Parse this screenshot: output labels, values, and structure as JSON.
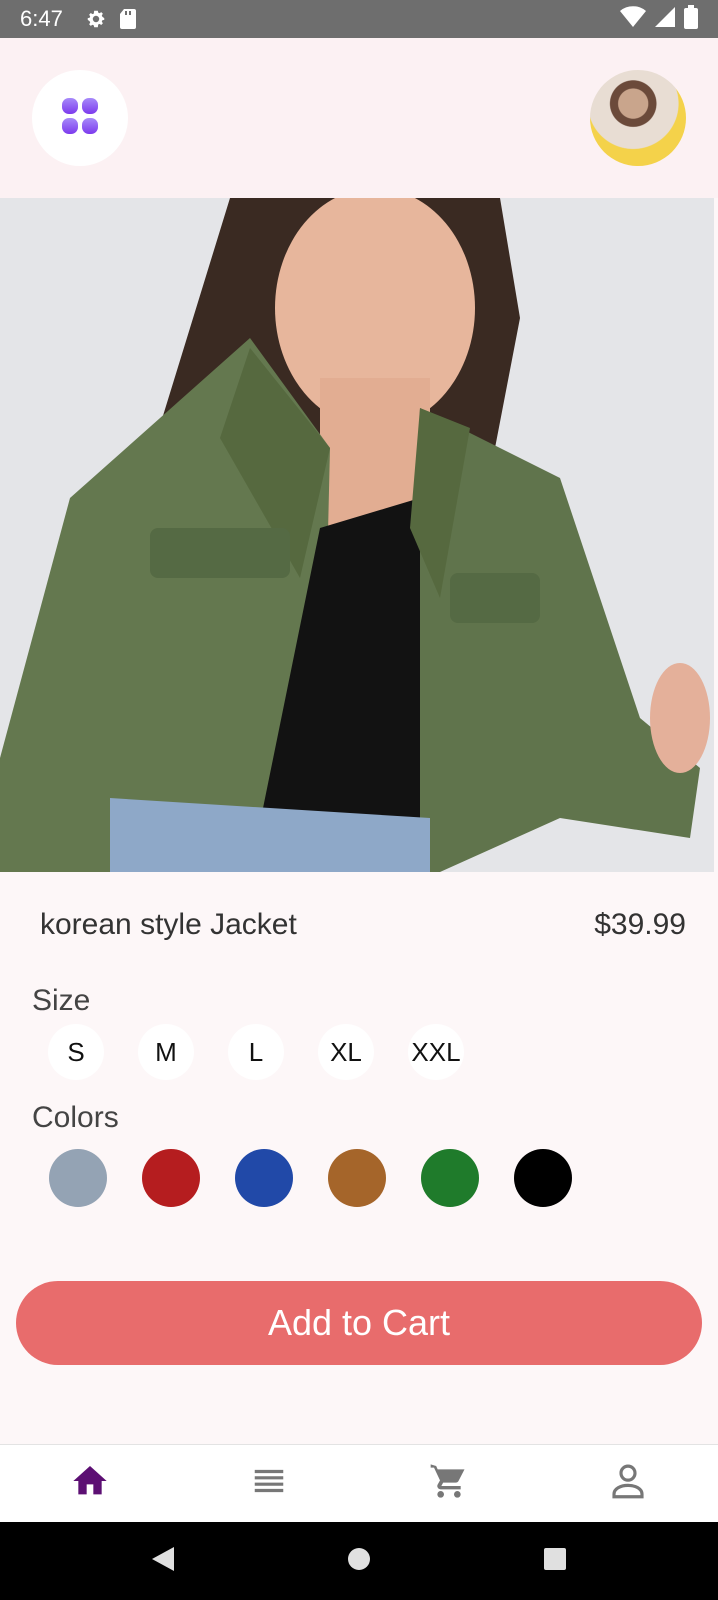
{
  "status_bar": {
    "time": "6:47"
  },
  "product": {
    "title": "korean style Jacket",
    "price": "$39.99"
  },
  "size": {
    "label": "Size",
    "options": [
      "S",
      "M",
      "L",
      "XL",
      "XXL"
    ]
  },
  "colors": {
    "label": "Colors",
    "options": [
      "#94a3b4",
      "#b51d1f",
      "#2149a8",
      "#a5652a",
      "#1f7b2b",
      "#000000"
    ]
  },
  "cart": {
    "button_label": "Add to Cart"
  },
  "bottom_nav": {
    "items": [
      "home-icon",
      "list-icon",
      "cart-icon",
      "profile-icon"
    ],
    "active_color": "#5c0f73",
    "inactive_color": "#777777"
  },
  "accent": {
    "cart_button": "#e86c6c",
    "menu_icon": "#8b5cf6"
  }
}
